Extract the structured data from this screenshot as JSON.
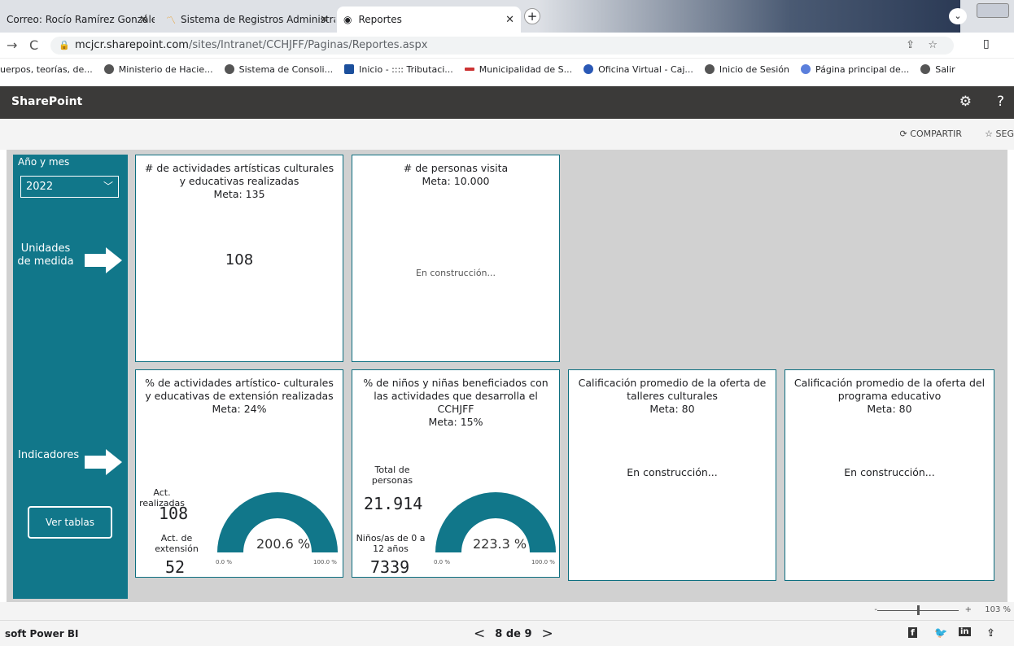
{
  "browser": {
    "tabs": [
      {
        "label": "Correo: Rocío Ramírez González -"
      },
      {
        "label": "Sistema de Registros Administrati"
      },
      {
        "label": "Reportes"
      }
    ],
    "url_host": "mcjcr.sharepoint.com",
    "url_path": "/sites/Intranet/CCHJFF/Paginas/Reportes.aspx",
    "bookmarks": [
      "uerpos, teorías, de...",
      "Ministerio de Hacie...",
      "Sistema de Consoli...",
      "Inicio - :::: Tributaci...",
      "Municipalidad de S...",
      "Oficina Virtual - Caj...",
      "Inicio de Sesión",
      "Página principal de...",
      "Salir"
    ]
  },
  "sharepoint": {
    "title": "SharePoint",
    "share_label": "COMPARTIR",
    "follow_label": "SEG"
  },
  "sidebar": {
    "period_label": "Año y mes",
    "year_value": "2022",
    "units_label": "Unidades de medida",
    "indicators_label": "Indicadores",
    "tables_button": "Ver tablas"
  },
  "cards": {
    "activities": {
      "title": "# de actividades artísticas culturales y educativas realizadas",
      "goal": "Meta: 135",
      "value": "108"
    },
    "visitors": {
      "title": "# de personas visita",
      "goal": "Meta: 10.000",
      "status": "En construcción..."
    },
    "extension": {
      "title": "% de actividades artístico- culturales y educativas de extensión realizadas",
      "goal": "Meta: 24%",
      "realized_label": "Act. realizadas",
      "realized_value": "108",
      "extension_label": "Act. de extensión",
      "extension_value": "52",
      "gauge_value": "200.6 %",
      "gauge_fraction": 1.0,
      "gauge_min": "0.0 %",
      "gauge_max": "100.0 %"
    },
    "children": {
      "title": "% de niños y niñas beneficiados con las actividades que desarrolla el CCHJFF",
      "goal": "Meta: 15%",
      "total_label": "Total de personas",
      "total_value": "21.914",
      "kids_label": "Niños/as de 0 a 12 años",
      "kids_value": "7339",
      "gauge_value": "223.3 %",
      "gauge_fraction": 1.0,
      "gauge_min": "0.0 %",
      "gauge_max": "100.0 %"
    },
    "workshops": {
      "title": "Calificación promedio de la oferta de talleres culturales",
      "goal": "Meta: 80",
      "status": "En construcción..."
    },
    "education": {
      "title": "Calificación promedio de la oferta del programa educativo",
      "goal": "Meta: 80",
      "status": "En construcción..."
    }
  },
  "zoom": {
    "minus": "-",
    "plus": "+",
    "value": "103 %"
  },
  "footer": {
    "app": "soft Power BI",
    "page_indicator": "8 de 9"
  },
  "colors": {
    "accent": "#11778a",
    "canvas": "#d1d1d1",
    "header": "#3b3a39"
  }
}
